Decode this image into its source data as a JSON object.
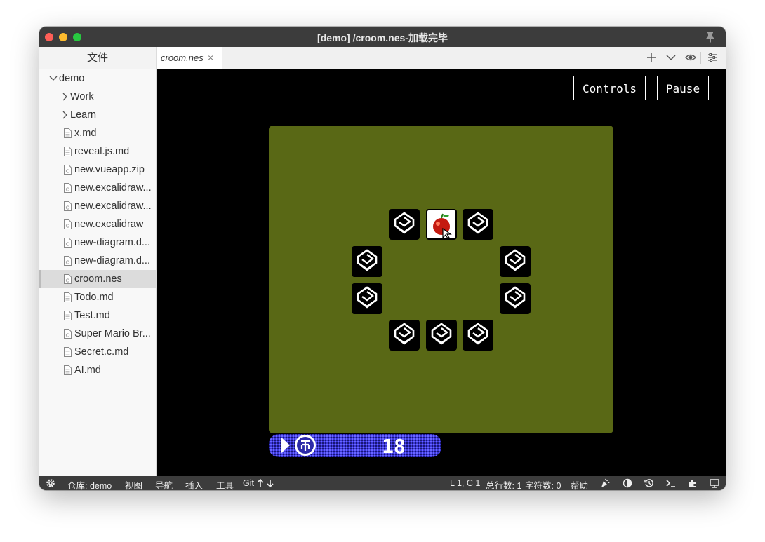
{
  "window": {
    "title": "[demo] /croom.nes-加载完毕"
  },
  "sidebar": {
    "header": "文件",
    "items": [
      {
        "label": "demo",
        "kind": "folder-open",
        "depth": 0
      },
      {
        "label": "Work",
        "kind": "folder",
        "depth": 1
      },
      {
        "label": "Learn",
        "kind": "folder",
        "depth": 1
      },
      {
        "label": "x.md",
        "kind": "file",
        "depth": 1
      },
      {
        "label": "reveal.js.md",
        "kind": "file",
        "depth": 1
      },
      {
        "label": "new.vueapp.zip",
        "kind": "file-special",
        "depth": 1
      },
      {
        "label": "new.excalidraw...",
        "kind": "file-special",
        "depth": 1
      },
      {
        "label": "new.excalidraw...",
        "kind": "file-special",
        "depth": 1
      },
      {
        "label": "new.excalidraw",
        "kind": "file-special",
        "depth": 1
      },
      {
        "label": "new-diagram.d...",
        "kind": "file-special",
        "depth": 1
      },
      {
        "label": "new-diagram.d...",
        "kind": "file-special",
        "depth": 1
      },
      {
        "label": "croom.nes",
        "kind": "file-special",
        "depth": 1,
        "selected": true
      },
      {
        "label": "Todo.md",
        "kind": "file",
        "depth": 1
      },
      {
        "label": "Test.md",
        "kind": "file",
        "depth": 1
      },
      {
        "label": "Super Mario Br...",
        "kind": "file-special",
        "depth": 1
      },
      {
        "label": "Secret.c.md",
        "kind": "file",
        "depth": 1
      },
      {
        "label": "AI.md",
        "kind": "file",
        "depth": 1
      }
    ]
  },
  "tabs": [
    {
      "label": "croom.nes",
      "close": "×",
      "active": true
    }
  ],
  "toolbar_icons": [
    "plus-icon",
    "chevron-down-icon",
    "eye-icon",
    "sliders-icon"
  ],
  "emulator": {
    "controls_label": "Controls",
    "pause_label": "Pause",
    "score": "18",
    "cards_open": [
      "apple"
    ],
    "colors": {
      "field": "#596815",
      "hud": "#3a36d8"
    }
  },
  "statusbar": {
    "repo": "仓库: demo",
    "view": "视图",
    "nav": "导航",
    "insert": "插入",
    "tools": "工具",
    "git": "Git",
    "position": "L 1, C 1",
    "total_lines": "总行数: 1",
    "char_count": "字符数: 0",
    "help": "帮助"
  }
}
